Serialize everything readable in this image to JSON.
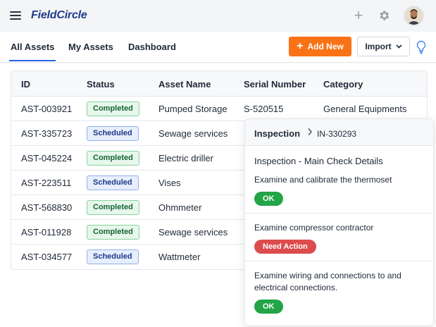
{
  "app": {
    "logo": "FieldCircle"
  },
  "nav": {
    "tabs": [
      {
        "label": "All Assets",
        "active": true
      },
      {
        "label": "My Assets",
        "active": false
      },
      {
        "label": "Dashboard",
        "active": false
      }
    ],
    "add_label": "Add New",
    "import_label": "Import"
  },
  "table": {
    "headers": [
      "ID",
      "Status",
      "Asset Name",
      "Serial Number",
      "Category"
    ],
    "rows": [
      {
        "id": "AST-003921",
        "status": "Completed",
        "name": "Pumped Storage",
        "serial": "S-520515",
        "category": "General Equipments"
      },
      {
        "id": "AST-335723",
        "status": "Scheduled",
        "name": "Sewage services",
        "serial": "",
        "category": ""
      },
      {
        "id": "AST-045224",
        "status": "Completed",
        "name": "Electric driller",
        "serial": "",
        "category": ""
      },
      {
        "id": "AST-223511",
        "status": "Scheduled",
        "name": "Vises",
        "serial": "",
        "category": ""
      },
      {
        "id": "AST-568830",
        "status": "Completed",
        "name": "Ohmmeter",
        "serial": "",
        "category": ""
      },
      {
        "id": "AST-011928",
        "status": "Completed",
        "name": "Sewage services",
        "serial": "",
        "category": ""
      },
      {
        "id": "AST-034577",
        "status": "Scheduled",
        "name": "Wattmeter",
        "serial": "",
        "category": ""
      }
    ]
  },
  "popup": {
    "title": "Inspection",
    "id": "IN-330293",
    "subtitle": "Inspection - Main Check Details",
    "checks": [
      {
        "text": "Examine and calibrate the thermoset",
        "result": "OK",
        "kind": "ok"
      },
      {
        "text": "Examine compressor contractor",
        "result": "Need Action",
        "kind": "bad"
      },
      {
        "text": "Examine wiring and connections to and electrical connections.",
        "result": "OK",
        "kind": "ok"
      }
    ]
  },
  "colors": {
    "accent": "#f97316",
    "link": "#2563eb",
    "ok": "#22a447",
    "need_action": "#dc4c4c"
  }
}
